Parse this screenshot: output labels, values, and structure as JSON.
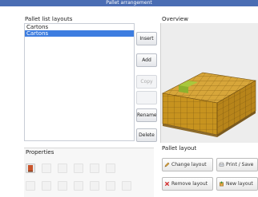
{
  "window": {
    "title": "Pallet arrangement"
  },
  "left": {
    "list_label": "Pallet list layouts",
    "items": [
      {
        "label": "Cartons",
        "selected": false
      },
      {
        "label": "Cartons",
        "selected": true
      }
    ],
    "buttons": [
      {
        "label": "Insert",
        "disabled": false
      },
      {
        "label": "Add",
        "disabled": false
      },
      {
        "label": "Copy",
        "disabled": true
      },
      {
        "label": "",
        "disabled": true
      },
      {
        "label": "Rename",
        "disabled": false
      },
      {
        "label": "Delete",
        "disabled": false
      }
    ],
    "properties_label": "Properties"
  },
  "right": {
    "overview_label": "Overview",
    "status_label": "Pallet layout",
    "actions": [
      {
        "label": "Change layout",
        "icon": "edit-icon"
      },
      {
        "label": "Print / Save",
        "icon": "print-icon"
      },
      {
        "label": "Remove layout",
        "icon": "delete-icon"
      },
      {
        "label": "New layout",
        "icon": "new-icon"
      }
    ]
  },
  "colors": {
    "selection": "#3d7de0",
    "carton": "#d3a12f",
    "carton_highlight": "#9bc23a",
    "titlebar": "#4a6db3"
  }
}
